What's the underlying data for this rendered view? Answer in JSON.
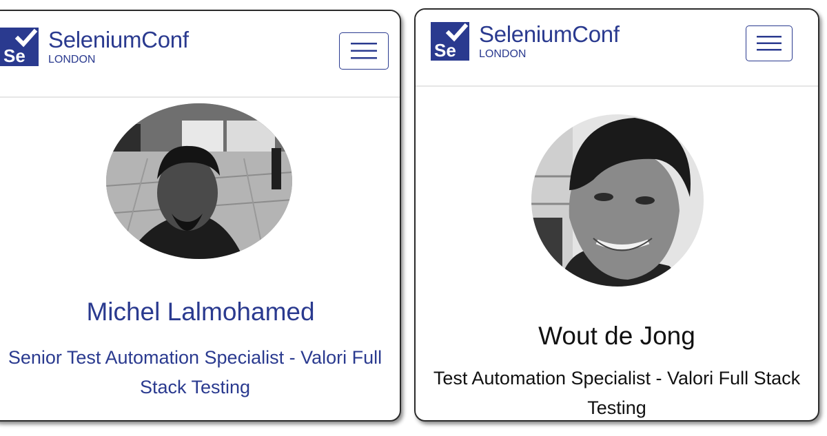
{
  "cards": [
    {
      "logo": {
        "title": "SeleniumConf",
        "subtitle": "LONDON",
        "mark_text": "Se"
      },
      "speaker": {
        "name": "Michel Lalmohamed",
        "role": "Senior Test Automation Specialist - Valori Full Stack Testing"
      }
    },
    {
      "logo": {
        "title": "SeleniumConf",
        "subtitle": "LONDON",
        "mark_text": "Se"
      },
      "speaker": {
        "name": "Wout de Jong",
        "role": "Test Automation Specialist - Valori Full Stack Testing"
      }
    }
  ],
  "colors": {
    "brand": "#2a3a8f",
    "text_dark": "#111111",
    "card_border": "#2b2b2b"
  },
  "icons": {
    "menu": "hamburger-menu-icon",
    "logo": "selenium-logo-icon"
  }
}
